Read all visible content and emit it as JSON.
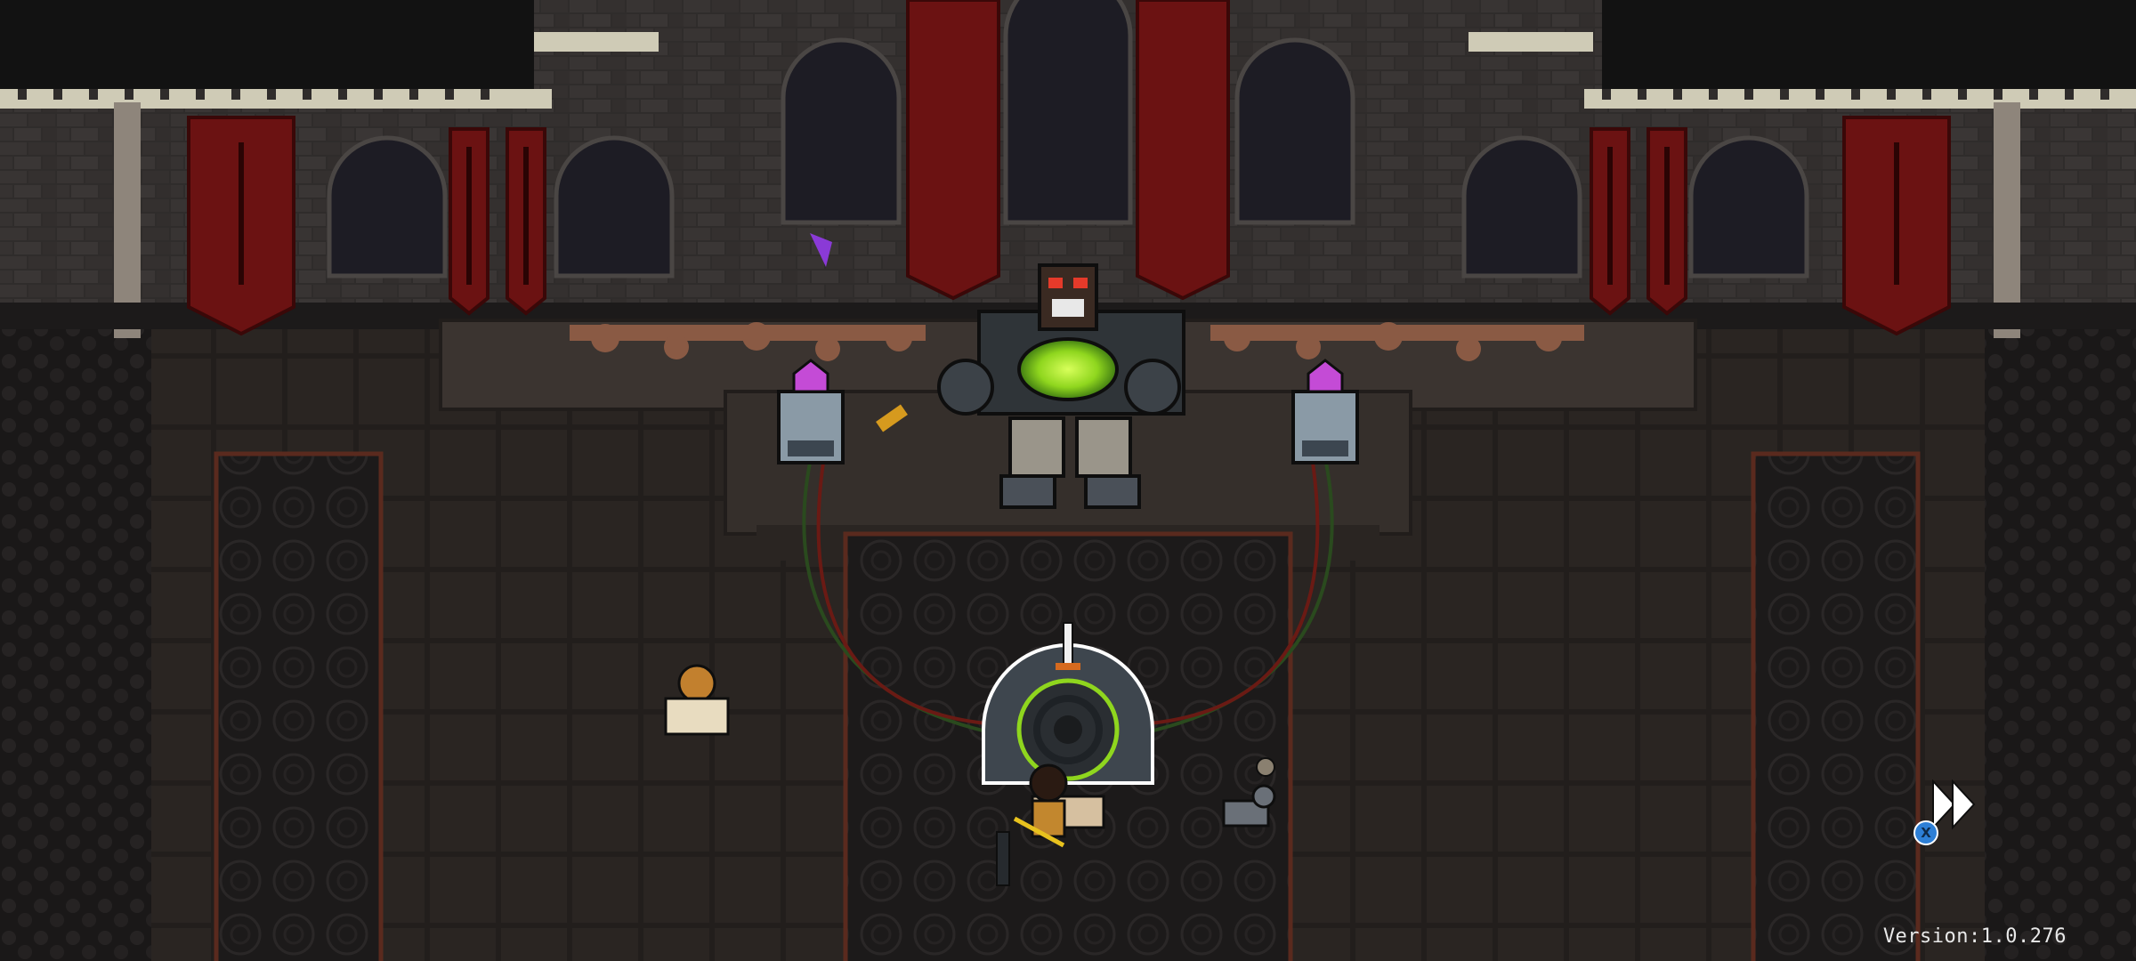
{
  "hud": {
    "version_text": "Version:1.0.276",
    "skip_button_glyph": "X",
    "skip_icon": "fast-forward-icon"
  },
  "colors": {
    "wall": "#2e2b2a",
    "wall_dark": "#1c1a1a",
    "floor": "#282320",
    "banner": "#6b1212",
    "crystal": "#c44bd6",
    "core_green": "#8fd61e",
    "button_blue": "#2d7fd6"
  }
}
